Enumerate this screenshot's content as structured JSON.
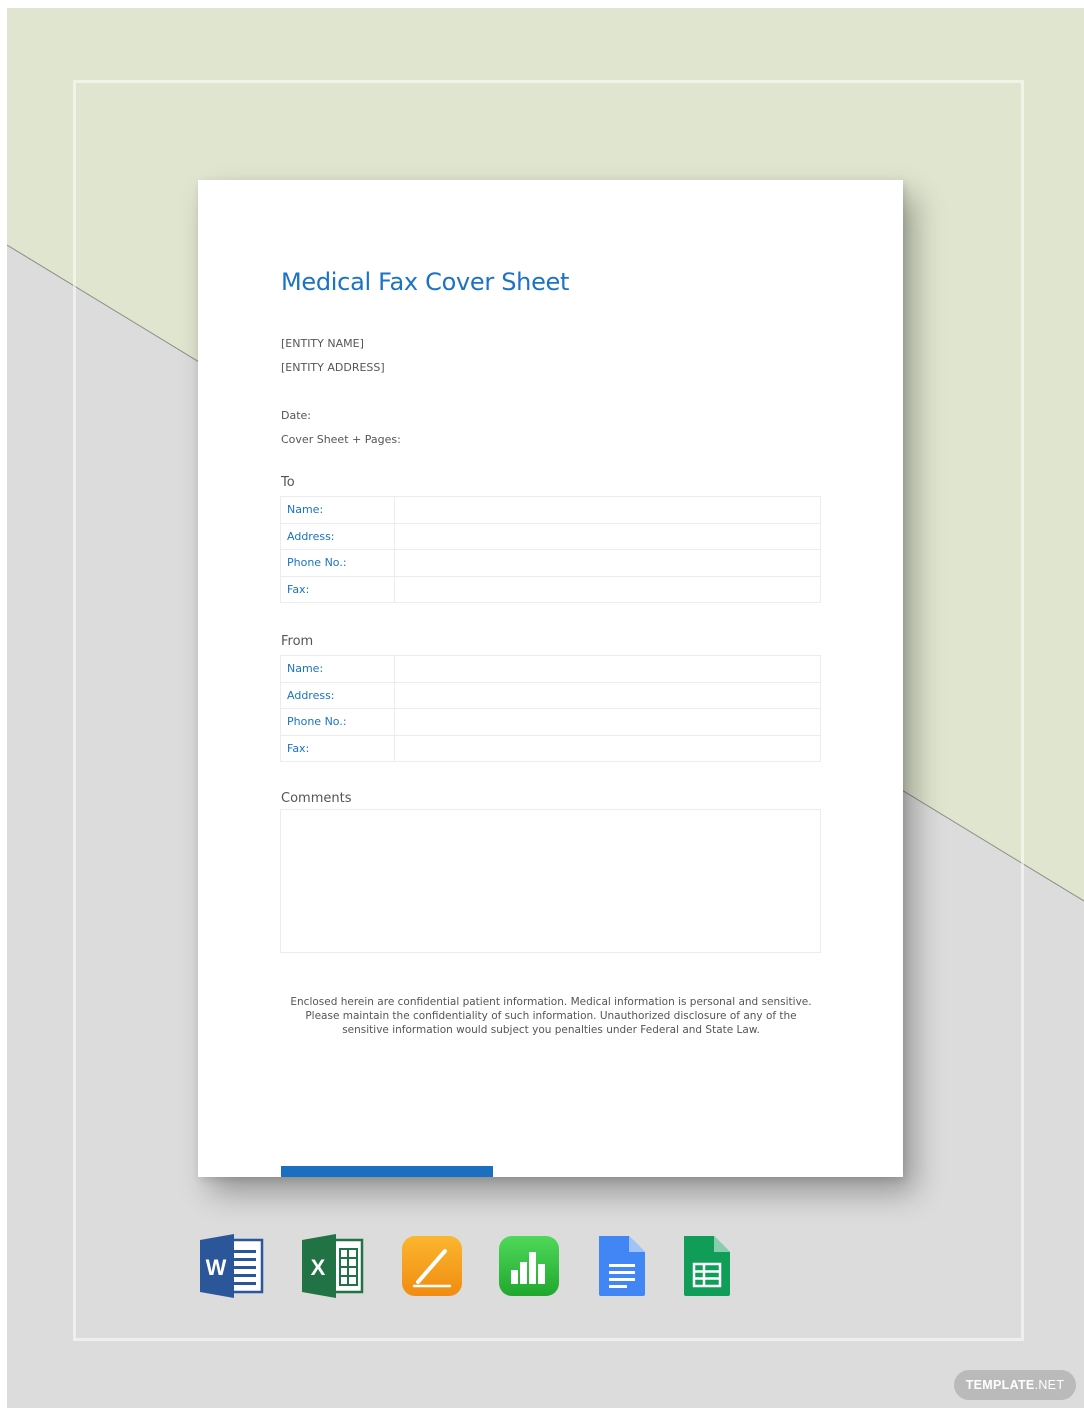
{
  "document": {
    "title": "Medical Fax Cover Sheet",
    "entity_name": "[ENTITY NAME]",
    "entity_address": "[ENTITY ADDRESS]",
    "date_label": "Date:",
    "pages_label": "Cover Sheet + Pages:",
    "to_section": {
      "heading": "To",
      "rows": [
        "Name:",
        "Address:",
        "Phone No.:",
        "Fax:"
      ]
    },
    "from_section": {
      "heading": "From",
      "rows": [
        "Name:",
        "Address:",
        "Phone No.:",
        "Fax:"
      ]
    },
    "comments_heading": "Comments",
    "disclaimer": [
      "Enclosed herein are confidential patient information. Medical information is personal and sensitive.",
      "Please maintain the confidentiality of such information.  Unauthorized disclosure of any of the",
      "sensitive information would subject you penalties under Federal and State Law."
    ]
  },
  "app_icons": [
    {
      "name": "word-icon",
      "letter": "W",
      "color": "#2b579a"
    },
    {
      "name": "excel-icon",
      "letter": "X",
      "color": "#217346"
    },
    {
      "name": "pages-icon",
      "color": "#f7a11a"
    },
    {
      "name": "numbers-icon",
      "color": "#2bc23e"
    },
    {
      "name": "google-docs-icon",
      "color": "#4285f4"
    },
    {
      "name": "google-sheets-icon",
      "color": "#0f9d58"
    }
  ],
  "watermark": {
    "brand": "TEMPLATE",
    "suffix": ".NET"
  },
  "colors": {
    "accent": "#1a73c4",
    "background_green": "#dfe5cf",
    "background_gray": "#dbdcdb"
  }
}
